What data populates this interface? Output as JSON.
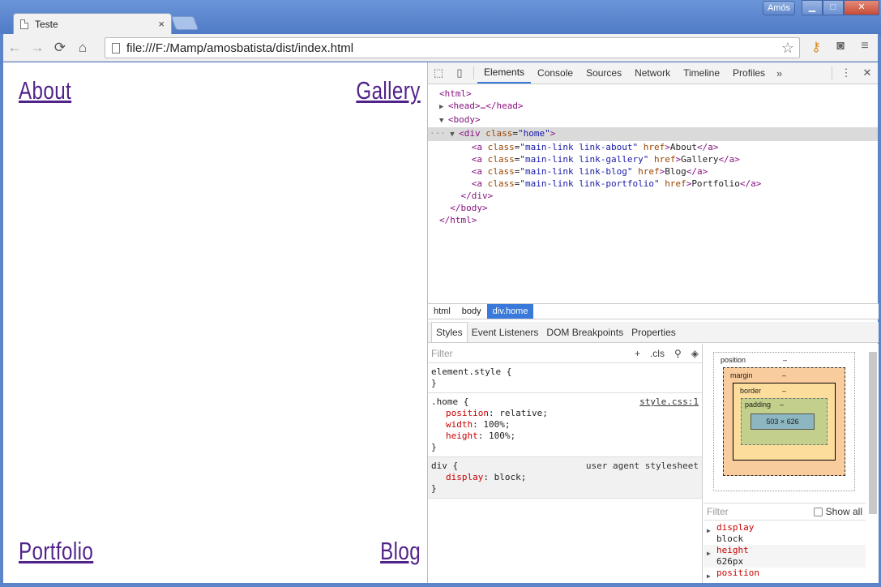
{
  "window": {
    "tab_title": "Teste",
    "tab_close": "×",
    "user_name": "Amós",
    "min_glyph": "▁",
    "max_glyph": "□",
    "close_glyph": "✕"
  },
  "toolbar": {
    "back_glyph": "←",
    "forward_glyph": "→",
    "reload_glyph": "⟳",
    "home_glyph": "⌂",
    "url": "file:///F:/Mamp/amosbatista/dist/index.html",
    "star_glyph": "☆",
    "key_glyph": "⚷",
    "camera_glyph": "◙",
    "menu_glyph": "≡"
  },
  "page": {
    "links": {
      "about": "About",
      "gallery": "Gallery",
      "portfolio": "Portfolio",
      "blog": "Blog"
    },
    "link_color": "#51238a"
  },
  "devtools": {
    "inspect_glyph": "⬚",
    "device_glyph": "▯",
    "tabs": [
      "Elements",
      "Console",
      "Sources",
      "Network",
      "Timeline",
      "Profiles"
    ],
    "more_glyph": "»",
    "kebab_glyph": "⋮",
    "close_glyph": "✕",
    "tree": {
      "html_open": "<html>",
      "head": "<head>…</head>",
      "body_open": "<body>",
      "div_tag": "div",
      "div_class_attr": "class",
      "div_class_val": "\"home\"",
      "a_about_class": "\"main-link link-about\"",
      "a_about_text": "About",
      "a_gallery_class": "\"main-link link-gallery\"",
      "a_gallery_text": "Gallery",
      "a_blog_class": "\"main-link link-blog\"",
      "a_blog_text": "Blog",
      "a_portfolio_class": "\"main-link link-portfolio\"",
      "a_portfolio_text": "Portfolio",
      "div_close": "</div>",
      "body_close": "</body>",
      "html_close": "</html>"
    },
    "breadcrumbs": [
      "html",
      "body",
      "div.home"
    ],
    "side_tabs": [
      "Styles",
      "Event Listeners",
      "DOM Breakpoints",
      "Properties"
    ],
    "styles": {
      "filter_placeholder": "Filter",
      "plus_glyph": "+",
      "cls_label": ".cls",
      "pin_glyph": "⚲",
      "color_glyph": "◈",
      "element_style": "element.style {",
      "close_brace": "}",
      "home_selector": ".home {",
      "home_source": "style.css:1",
      "home_props": [
        {
          "name": "position",
          "value": "relative;"
        },
        {
          "name": "width",
          "value": "100%;"
        },
        {
          "name": "height",
          "value": "100%;"
        }
      ],
      "div_selector": "div {",
      "div_source": "user agent stylesheet",
      "div_props": [
        {
          "name": "display",
          "value": "block;"
        }
      ]
    },
    "box_model": {
      "position_label": "position",
      "position_value": "–",
      "margin_label": "margin",
      "margin_value": "–",
      "border_label": "border",
      "border_value": "–",
      "padding_label": "padding",
      "padding_value": "–",
      "content_size": "503 × 626",
      "dash": "–"
    },
    "computed": {
      "filter_placeholder": "Filter",
      "show_all": "Show all",
      "items": [
        {
          "name": "display",
          "value": "block"
        },
        {
          "name": "height",
          "value": "626px"
        },
        {
          "name": "position",
          "value": ""
        }
      ]
    }
  }
}
